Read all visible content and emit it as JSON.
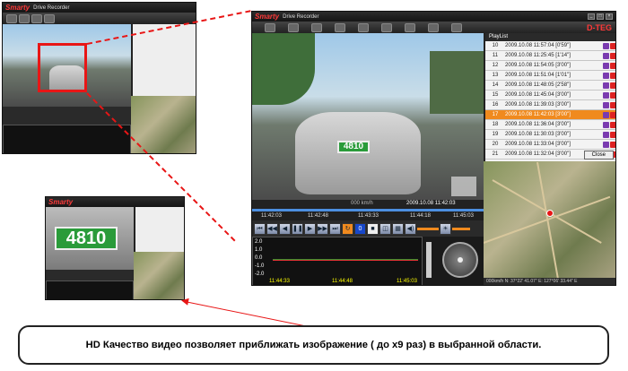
{
  "main_window": {
    "logo": "Smarty",
    "title": "Drive Recorder",
    "brand": "D-TEG",
    "speed_label": "000 km/h",
    "timestamp": "2009.10.08 11:42:03",
    "plate": "4810",
    "timeline_ticks": [
      "11:42:03",
      "11:42:48",
      "11:43:33",
      "11:44:18",
      "11:45:03"
    ],
    "graph_ticks": [
      "11:44:33",
      "11:44:48",
      "11:45:03"
    ],
    "graph_labels": [
      "2.0",
      "1.0",
      "0.0",
      "-1.0",
      "-2.0"
    ],
    "speed_value": "0",
    "status_text": "000km/h  N: 37°22' 41.07\"  E: 127°06' 33.44\" E"
  },
  "playlist": {
    "title": "PlayList",
    "close_label": "Close",
    "rows": [
      {
        "n": "10",
        "d": "2009.10.08 11:57:04 [0'59\"]"
      },
      {
        "n": "11",
        "d": "2009.10.08 11:25:45 [1'14\"]"
      },
      {
        "n": "12",
        "d": "2009.10.08 11:54:05 [3'00\"]"
      },
      {
        "n": "13",
        "d": "2009.10.08 11:51:04 [1'01\"]"
      },
      {
        "n": "14",
        "d": "2009.10.08 11:48:05 [2'58\"]"
      },
      {
        "n": "15",
        "d": "2009.10.08 11:45:04 [3'00\"]"
      },
      {
        "n": "16",
        "d": "2009.10.08 11:39:03 [3'00\"]"
      },
      {
        "n": "17",
        "d": "2009.10.08 11:42:03 [3'00\"]"
      },
      {
        "n": "18",
        "d": "2009.10.08 11:36:04 [3'00\"]"
      },
      {
        "n": "19",
        "d": "2009.10.08 11:30:03 [3'00\"]"
      },
      {
        "n": "20",
        "d": "2009.10.08 11:33:04 [3'00\"]"
      },
      {
        "n": "21",
        "d": "2009.10.08 11:32:04 [3'00\"]"
      },
      {
        "n": "22",
        "d": "2009.10.08 11:33:05 [2'58\"]"
      }
    ],
    "selected_index": 7
  },
  "thumb_top": {
    "plate": "4810"
  },
  "thumb_bottom": {
    "plate": "4810"
  },
  "caption": "HD Качество видео позволяет приближать изображение ( до x9 раз) в выбранной области.",
  "colors": {
    "accent": "#e81616",
    "selected": "#f08a1e",
    "brand": "#ff3838"
  }
}
